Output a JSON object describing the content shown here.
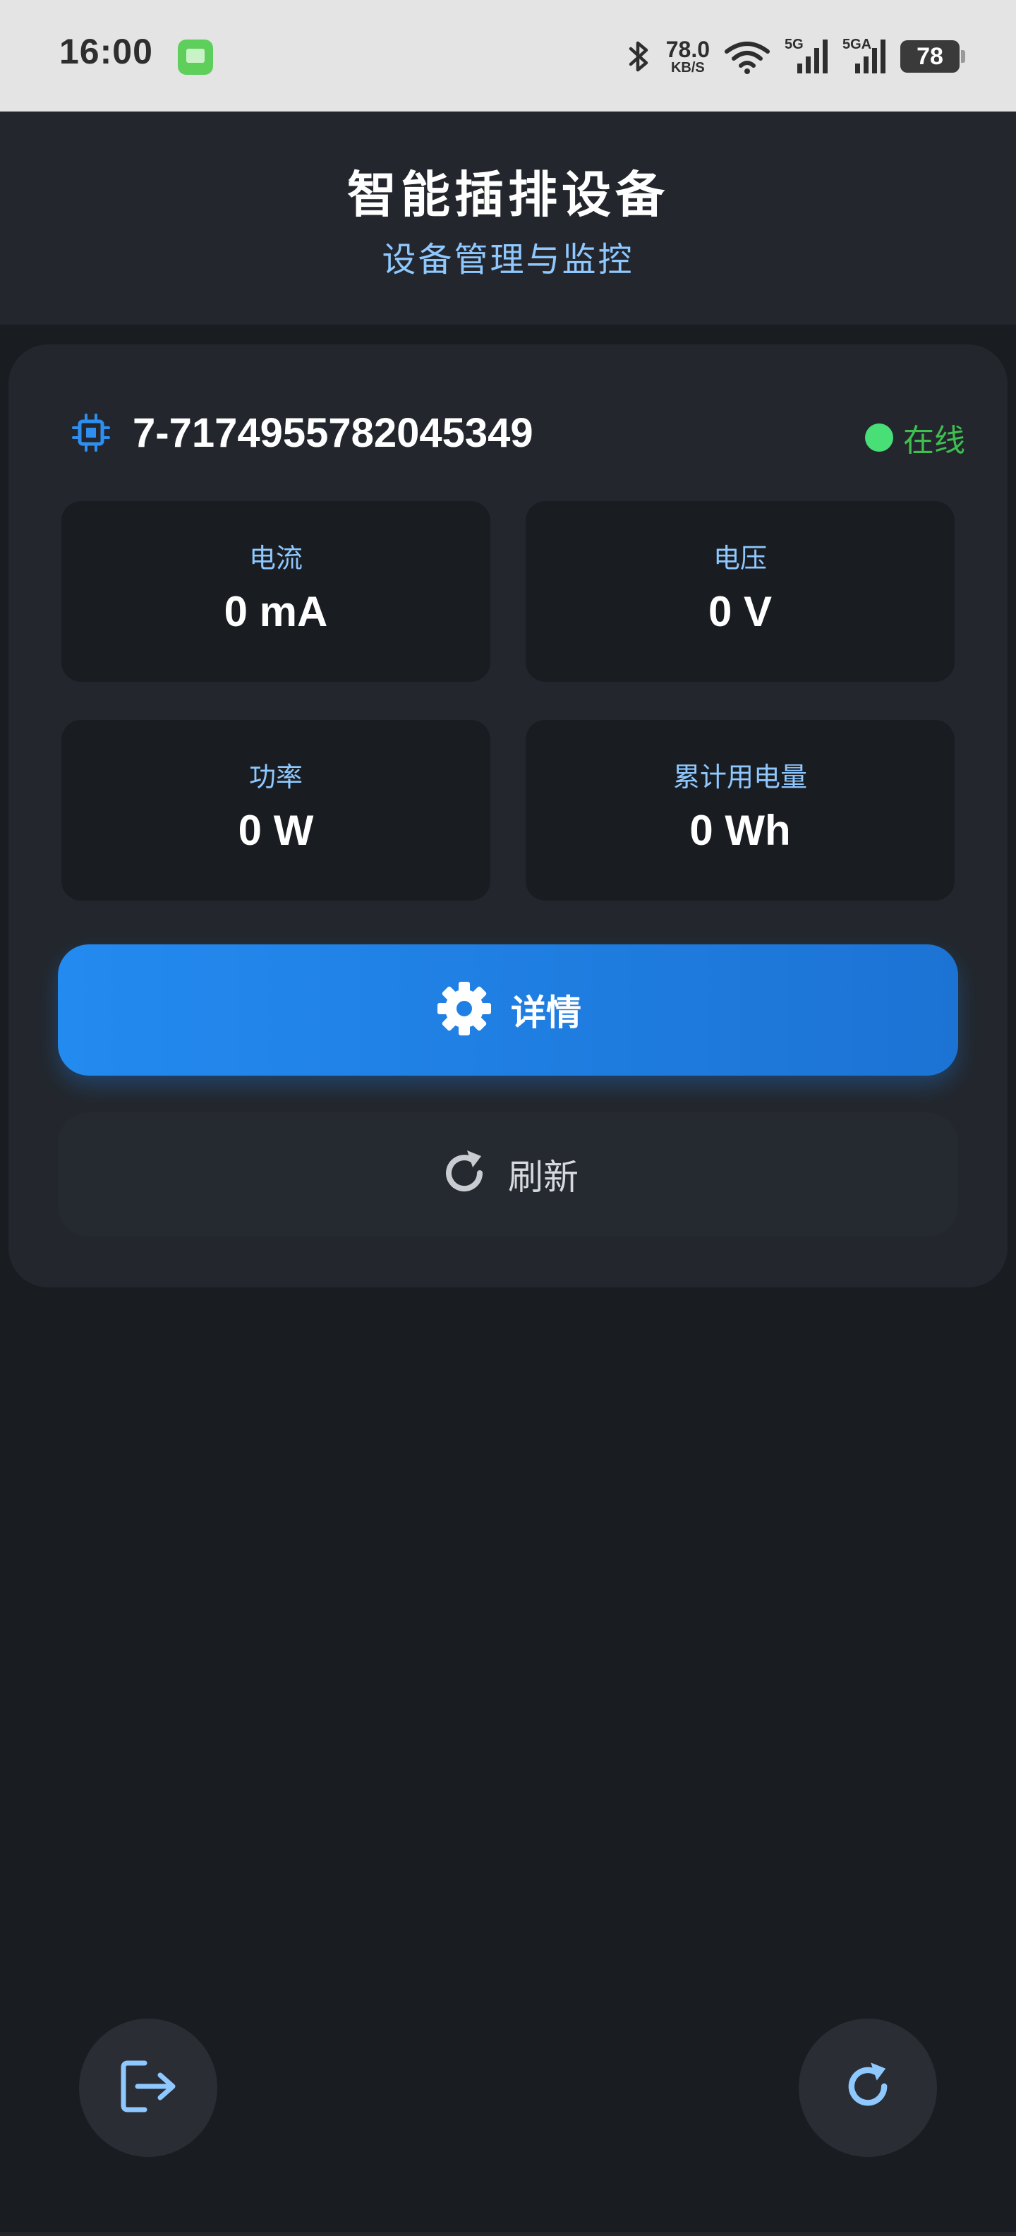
{
  "status_bar": {
    "time": "16:00",
    "net_speed_value": "78.0",
    "net_speed_unit": "KB/S",
    "sim1_label": "5G",
    "sim2_label": "5GA",
    "battery": "78"
  },
  "header": {
    "title": "智能插排设备",
    "subtitle": "设备管理与监控"
  },
  "device": {
    "id": "7-7174955782045349",
    "status": "在线",
    "status_color": "#48df77",
    "metrics": [
      {
        "label": "电流",
        "value": "0 mA"
      },
      {
        "label": "电压",
        "value": "0 V"
      },
      {
        "label": "功率",
        "value": "0 W"
      },
      {
        "label": "累计用电量",
        "value": "0 Wh"
      }
    ]
  },
  "actions": {
    "details_label": "详情",
    "details_icon": "gear-icon",
    "refresh_label": "刷新",
    "refresh_icon": "refresh-icon"
  },
  "fabs": {
    "logout_icon": "logout-icon",
    "refresh_icon": "refresh-icon"
  },
  "colors": {
    "accent": "#238af0",
    "label_blue": "#8ec8ff",
    "online_green": "#3fbf4f",
    "background": "#191c21",
    "card": "#23272d"
  }
}
